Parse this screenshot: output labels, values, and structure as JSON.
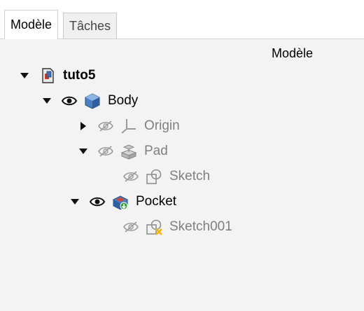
{
  "tabs": [
    {
      "label": "Modèle",
      "active": true
    },
    {
      "label": "Tâches",
      "active": false
    }
  ],
  "tree": {
    "header": "Modèle",
    "items": [
      {
        "label": "tuto5",
        "level": 0,
        "expander": "down",
        "eye": "none",
        "icon": "document-icon",
        "style": "bold"
      },
      {
        "label": "Body",
        "level": 1,
        "expander": "down",
        "eye": "visible",
        "icon": "body-icon",
        "style": "normal"
      },
      {
        "label": "Origin",
        "level": 2,
        "expander": "right",
        "eye": "hidden",
        "icon": "origin-icon",
        "style": "dim"
      },
      {
        "label": "Pad",
        "level": 2,
        "expander": "down",
        "eye": "hidden",
        "icon": "pad-icon",
        "style": "dim"
      },
      {
        "label": "Sketch",
        "level": 3,
        "expander": "none",
        "eye": "hidden",
        "icon": "sketch-icon",
        "style": "dim"
      },
      {
        "label": "Pocket",
        "level": 2,
        "expander": "down",
        "eye": "visible",
        "icon": "pocket-icon",
        "style": "normal"
      },
      {
        "label": "Sketch001",
        "level": 3,
        "expander": "none",
        "eye": "hidden",
        "icon": "sketch-error-icon",
        "style": "dim"
      }
    ]
  },
  "colors": {
    "body_blue": "#4a7fc0",
    "pocket_red": "#d9452e",
    "warn_yellow": "#f2b600",
    "add_green": "#2f9e3a"
  }
}
